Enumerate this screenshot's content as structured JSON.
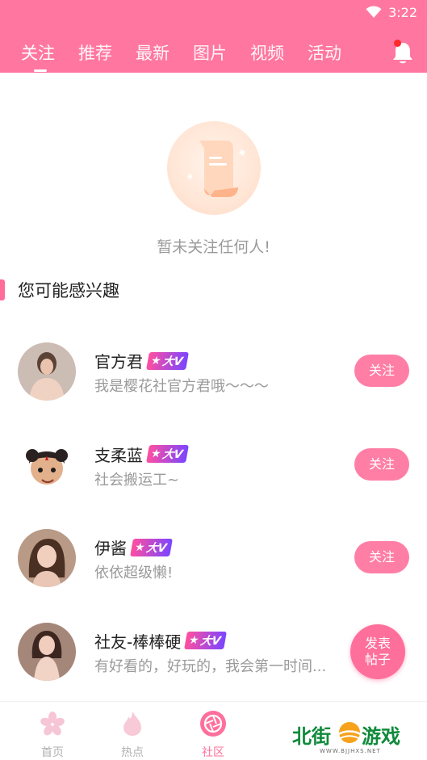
{
  "status": {
    "time": "3:22"
  },
  "tabs": [
    {
      "label": "关注"
    },
    {
      "label": "推荐"
    },
    {
      "label": "最新"
    },
    {
      "label": "图片"
    },
    {
      "label": "视频"
    },
    {
      "label": "活动"
    }
  ],
  "empty": {
    "message": "暂未关注任何人!"
  },
  "section": {
    "title": "您可能感兴趣"
  },
  "users": [
    {
      "name": "官方君",
      "bio": "我是樱花社官方君哦～～～",
      "badge": "大V",
      "action": "关注"
    },
    {
      "name": "支柔蓝",
      "bio": "社会搬运工~",
      "badge": "大V",
      "action": "关注"
    },
    {
      "name": "伊酱",
      "bio": "依依超级懒!",
      "badge": "大V",
      "action": "关注"
    },
    {
      "name": "社友-棒棒硬",
      "bio": "有好看的，好玩的，我会第一时间...",
      "badge": "大V",
      "action": "发表帖子"
    }
  ],
  "fab": {
    "line1": "发表",
    "line2": "帖子"
  },
  "bottom_nav": [
    {
      "label": "首页"
    },
    {
      "label": "热点"
    },
    {
      "label": "社区"
    }
  ],
  "watermark": {
    "brand_left": "北街",
    "brand_right": "游戏",
    "domain": "WWW.BJJHXS.NET"
  },
  "colors": {
    "brand_pink": "#ff77a0",
    "button_pink": "#ff7ea6",
    "text_dark": "#222222",
    "text_muted": "#9a9a9a"
  }
}
